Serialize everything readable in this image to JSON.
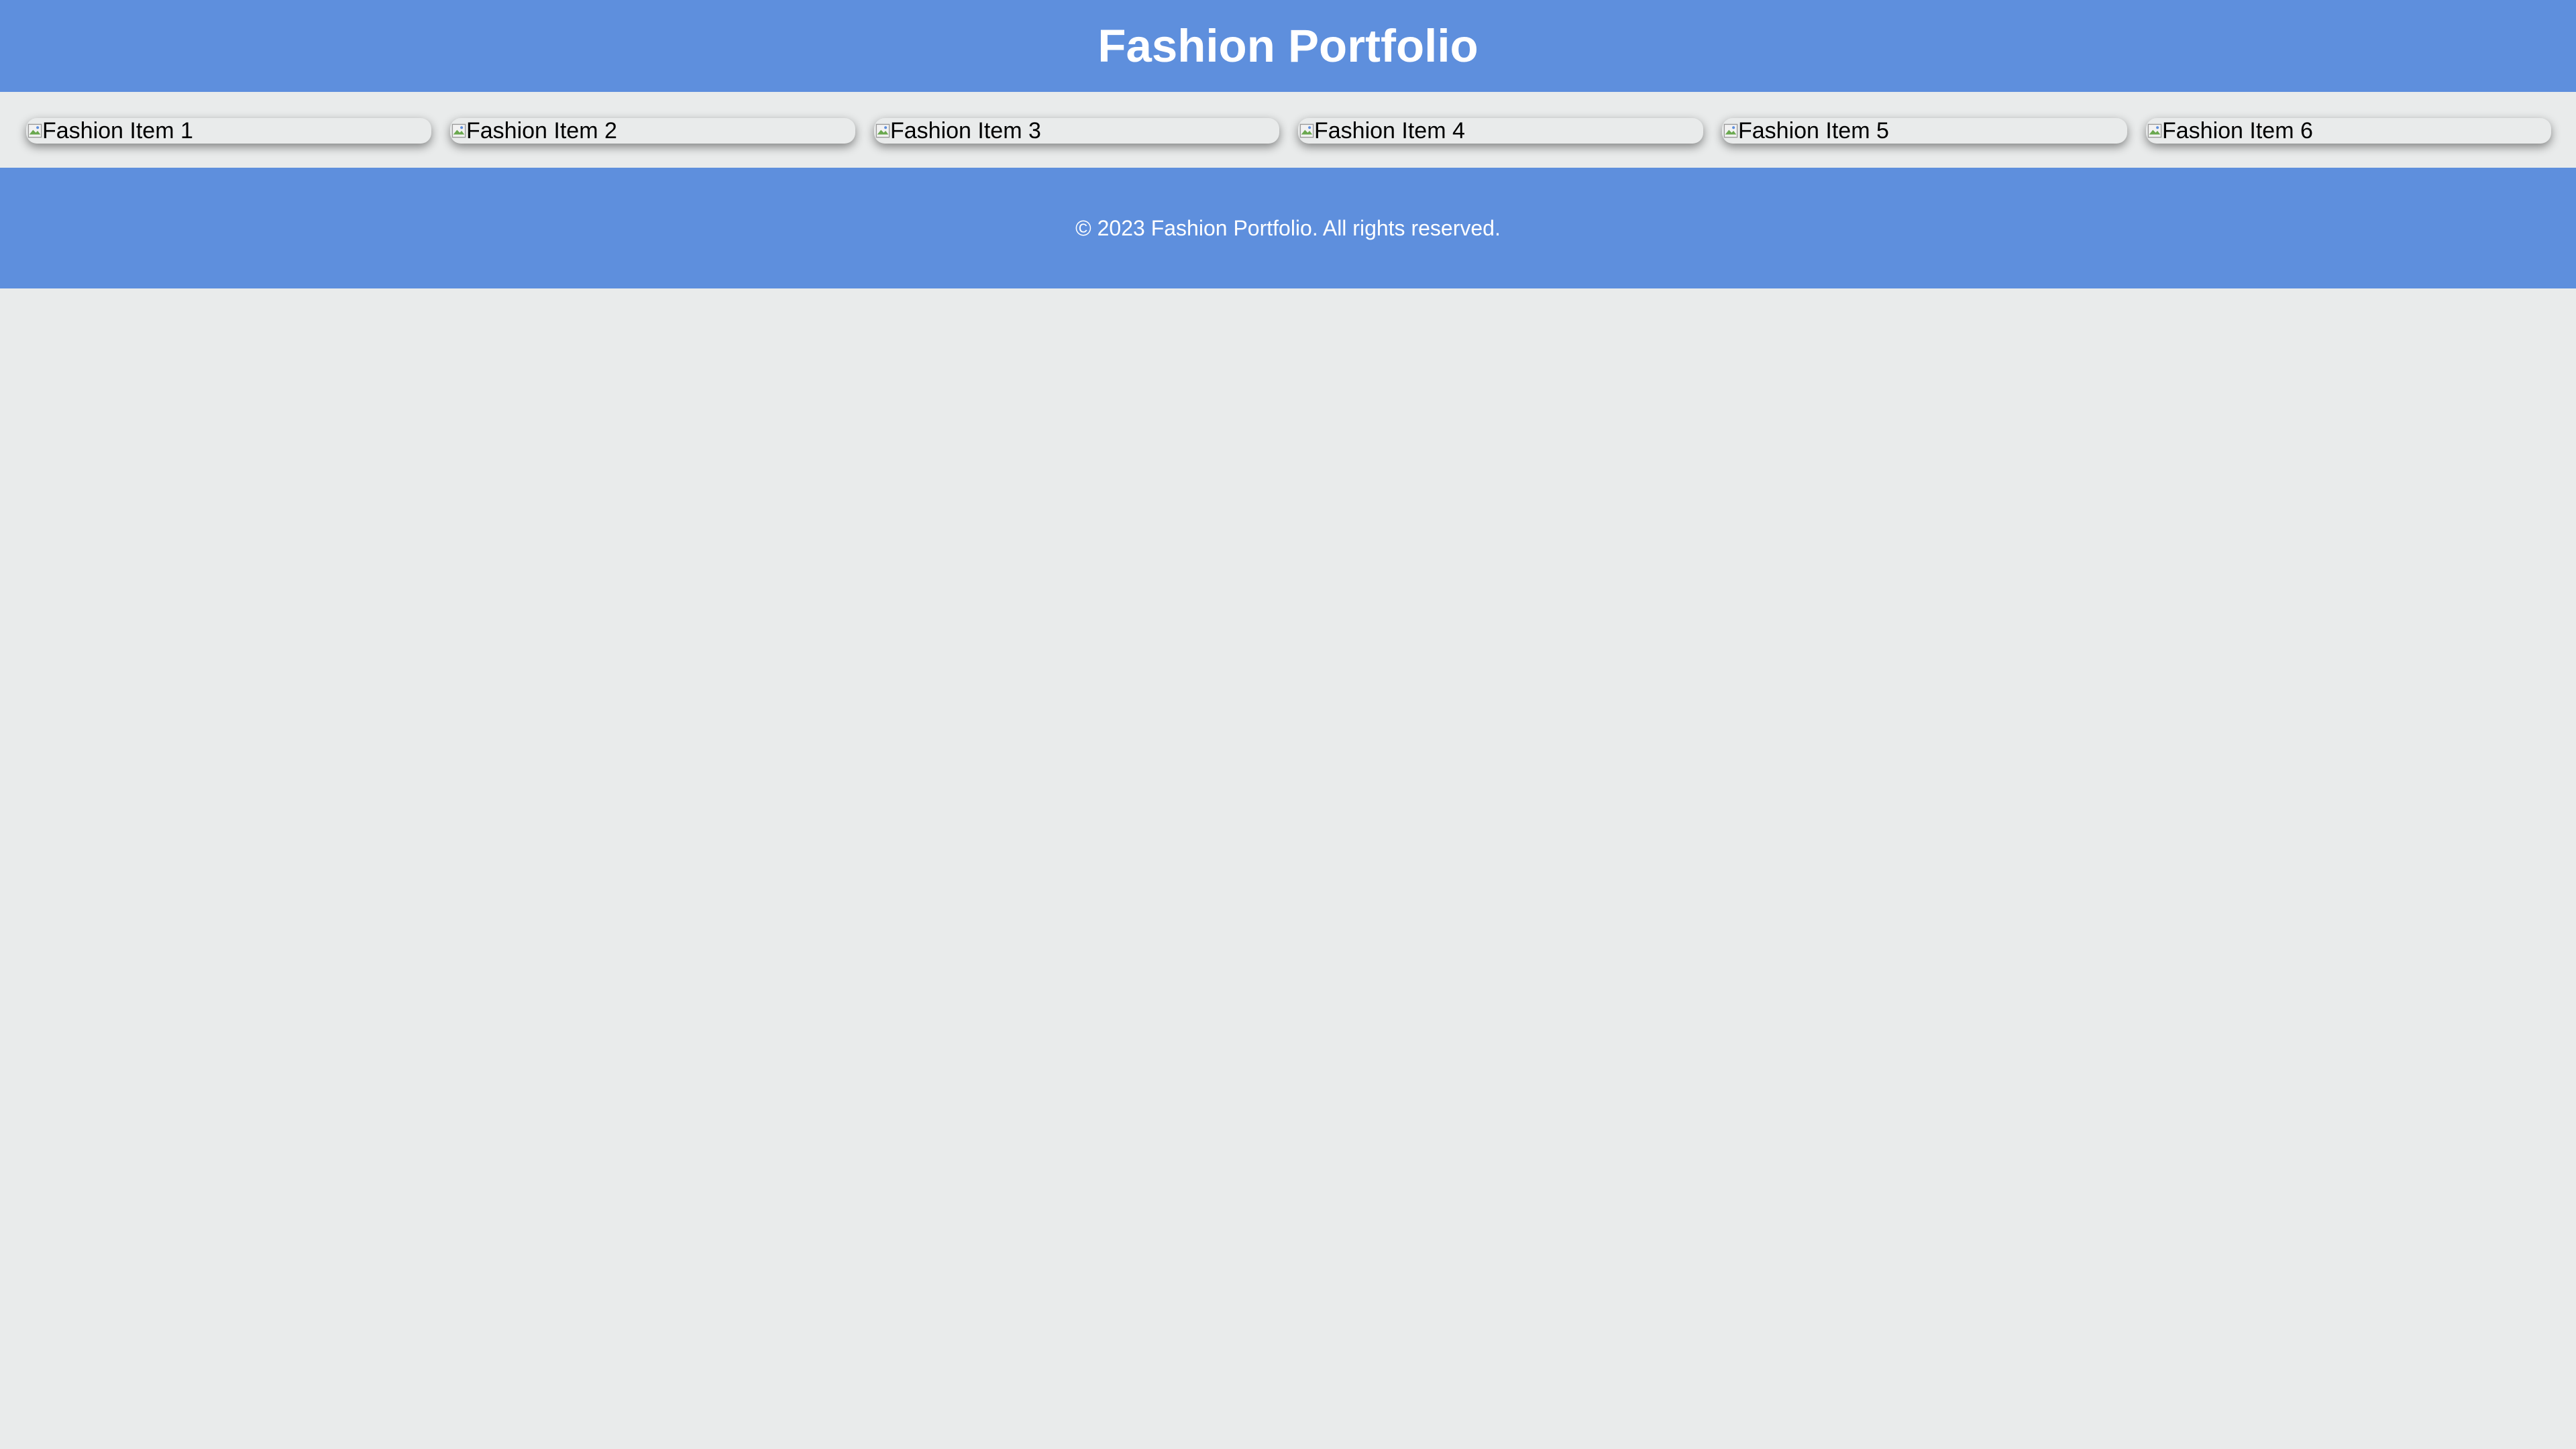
{
  "header": {
    "title": "Fashion Portfolio"
  },
  "gallery": {
    "items": [
      {
        "alt": "Fashion Item 1",
        "icon": "broken-image-icon"
      },
      {
        "alt": "Fashion Item 2",
        "icon": "broken-image-icon"
      },
      {
        "alt": "Fashion Item 3",
        "icon": "broken-image-icon"
      },
      {
        "alt": "Fashion Item 4",
        "icon": "broken-image-icon"
      },
      {
        "alt": "Fashion Item 5",
        "icon": "broken-image-icon"
      },
      {
        "alt": "Fashion Item 6",
        "icon": "broken-image-icon"
      }
    ]
  },
  "footer": {
    "copyright": "© 2023 Fashion Portfolio. All rights reserved."
  },
  "colors": {
    "header_background": "#5e8fdd",
    "page_background": "#e9ebeb",
    "text_light": "#ffffff"
  }
}
